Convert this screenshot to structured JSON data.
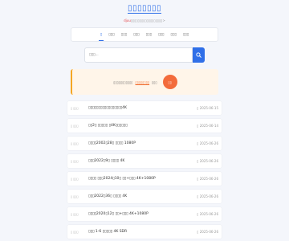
{
  "header": {
    "title": "▯▯▯▯▯▯▯",
    "subtitle_prefix": "djuu",
    "subtitle_rest": "▯▯▯▯▯▯▯▯▯▯▯▯▯▯▯▯▯▯>"
  },
  "nav": {
    "tabs": [
      "▯",
      "▯▯▯",
      "▯▯▯",
      "▯▯▯",
      "▯▯▯",
      "▯▯▯",
      "▯▯▯",
      "▯▯▯"
    ]
  },
  "search": {
    "placeholder": "▯▯▯..."
  },
  "notice": {
    "text": "▯▯▯▯▯▯▯▯▯▯▯",
    "link": "▯▯▯▯▯▯▯▯",
    "suffix": "▯▯▯",
    "cta": "▯▯"
  },
  "items": [
    {
      "tag": "▯ ▯▯▯",
      "name": "▯▯▯▯▯▯▯▯▯▯▯▯▯▯▯▯▯4K",
      "date": "▯ 2025-06-15"
    },
    {
      "tag": "▯ ▯▯▯",
      "name": "▯▯2▯ ▯▯▯▯▯ ▯4K▯▯▯▯▯▯",
      "date": "▯ 2025-06-14"
    },
    {
      "tag": "▯ ▯▯▯",
      "name": "▯▯▯▯2002▯28▯ ▯▯▯▯ 1080P",
      "date": "▯ 2025-06-26"
    },
    {
      "tag": "▯ ▯▯▯",
      "name": "▯▯▯2022▯9▯ ▯▯▯▯ 4K",
      "date": "▯ 2025-06-26"
    },
    {
      "tag": "▯ ▯▯▯",
      "name": "▯▯▯▯ ▯▯▯2024▯10▯ ▯▯+▯▯▯ 4K+1080P",
      "date": "▯ 2025-06-26"
    },
    {
      "tag": "▯ ▯▯▯",
      "name": "▯▯▯2022▯36▯ ▯▯▯▯ 4K",
      "date": "▯ 2025-06-26"
    },
    {
      "tag": "▯ ▯▯▯",
      "name": "▯▯▯▯2020▯12▯ ▯▯+▯▯▯ 4K+1080P",
      "date": "▯ 2025-06-26"
    },
    {
      "tag": "▯ ▯▯▯",
      "name": "▯▯▯ 1-6 ▯▯▯▯▯ 4K SDR",
      "date": "▯ 2025-06-26"
    }
  ]
}
